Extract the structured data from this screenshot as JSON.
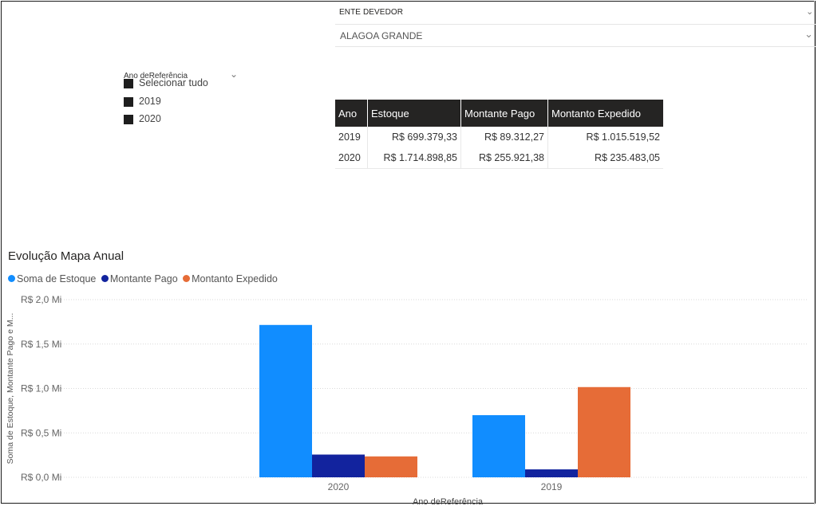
{
  "ente_slicer": {
    "title": "ENTE DEVEDOR",
    "selected": "ALAGOA GRANDE"
  },
  "year_slicer": {
    "title": "Ano deReferência",
    "items": [
      "Selecionar tudo",
      "2019",
      "2020"
    ]
  },
  "table": {
    "headers": [
      "Ano",
      "Estoque",
      "Montante Pago",
      "Montanto Expedido"
    ],
    "rows": [
      [
        "2019",
        "R$ 699.379,33",
        "R$ 89.312,27",
        "R$ 1.015.519,52"
      ],
      [
        "2020",
        "R$ 1.714.898,85",
        "R$ 255.921,38",
        "R$ 235.483,05"
      ]
    ]
  },
  "colors": {
    "estoque": "#118DFF",
    "pago": "#12239E",
    "expedido": "#E66C37",
    "header_bg": "#252423"
  },
  "chart": {
    "title": "Evolução Mapa Anual",
    "legend": [
      {
        "label": "Soma de Estoque",
        "color": "#118DFF"
      },
      {
        "label": "Montante Pago",
        "color": "#12239E"
      },
      {
        "label": "Montanto Expedido",
        "color": "#E66C37"
      }
    ]
  },
  "chart_data": {
    "type": "bar",
    "title": "Evolução Mapa Anual",
    "categories": [
      "2020",
      "2019"
    ],
    "series": [
      {
        "name": "Soma de Estoque",
        "values": [
          1714898.85,
          699379.33
        ]
      },
      {
        "name": "Montante Pago",
        "values": [
          255921.38,
          89312.27
        ]
      },
      {
        "name": "Montanto Expedido",
        "values": [
          235483.05,
          1015519.52
        ]
      }
    ],
    "xlabel": "Ano deReferência",
    "ylabel": "Soma de Estoque, Montante Pago e M...",
    "ylim": [
      0,
      2000000
    ],
    "yticks": [
      "R$ 0,0 Mi",
      "R$ 0,5 Mi",
      "R$ 1,0 Mi",
      "R$ 1,5 Mi",
      "R$ 2,0 Mi"
    ],
    "grid": true,
    "legend_position": "top-left"
  }
}
